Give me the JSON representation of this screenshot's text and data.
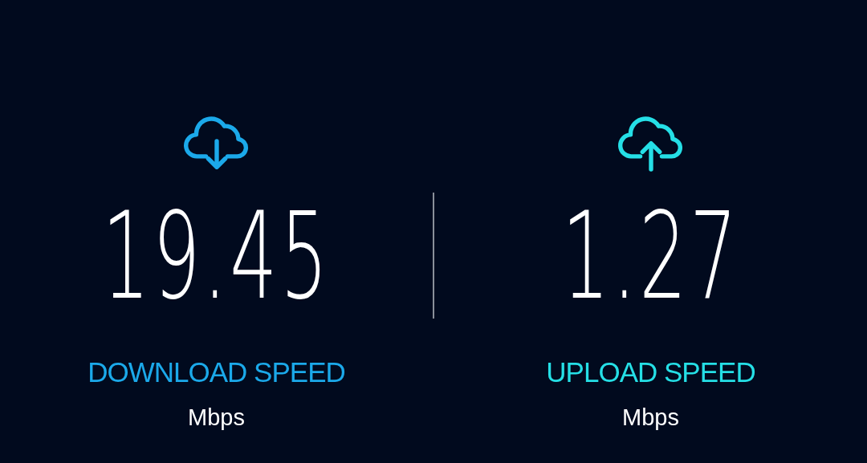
{
  "speeds": [
    {
      "kind": "download",
      "value": "19.45",
      "label": "DOWNLOAD SPEED",
      "unit": "Mbps",
      "color": "#1ba9ea"
    },
    {
      "kind": "upload",
      "value": "1.27",
      "label": "UPLOAD SPEED",
      "unit": "Mbps",
      "color": "#25dfe6"
    }
  ]
}
